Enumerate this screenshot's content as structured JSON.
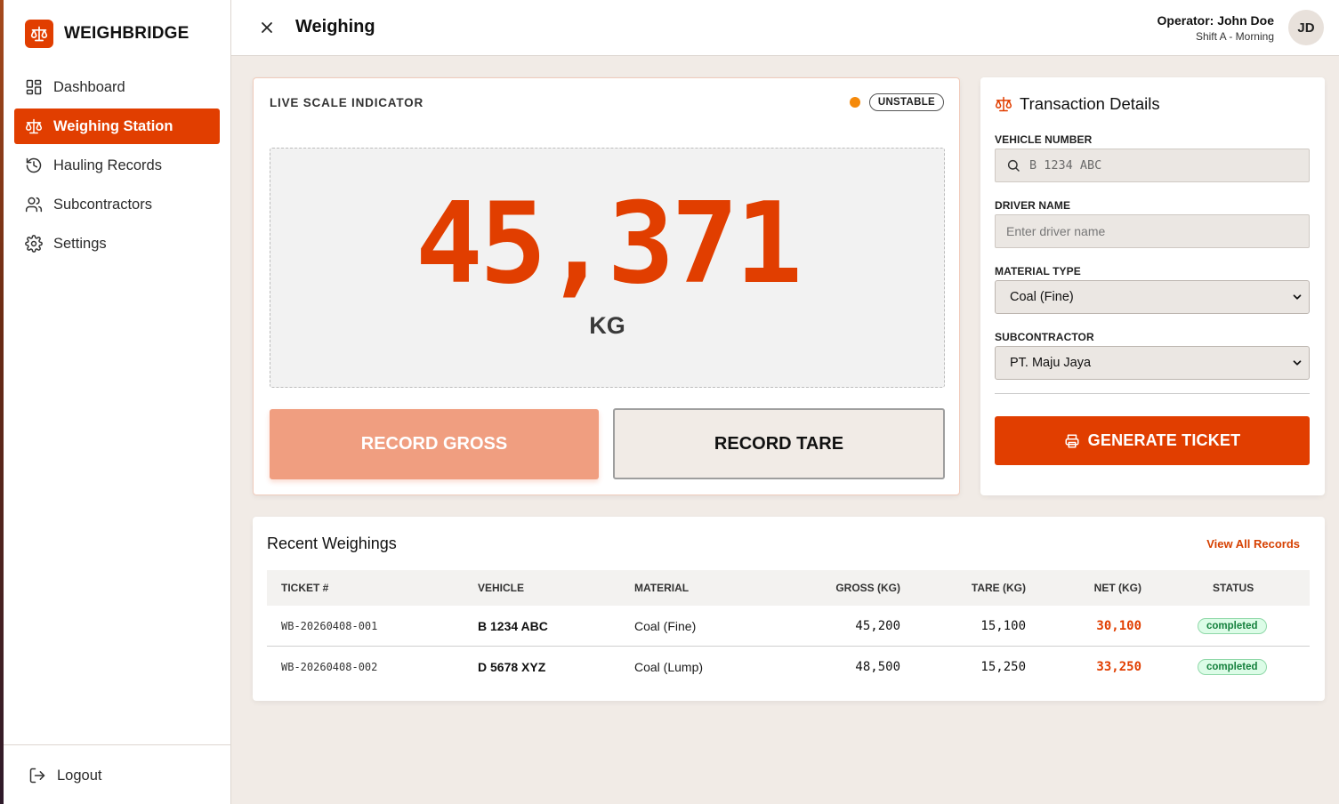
{
  "brand": {
    "name": "WEIGHBRIDGE",
    "logo_icon": "scale-icon"
  },
  "sidebar": {
    "items": [
      {
        "label": "Dashboard",
        "icon": "dashboard-icon",
        "active": false
      },
      {
        "label": "Weighing Station",
        "icon": "scale-icon",
        "active": true
      },
      {
        "label": "Hauling Records",
        "icon": "history-icon",
        "active": false
      },
      {
        "label": "Subcontractors",
        "icon": "users-icon",
        "active": false
      },
      {
        "label": "Settings",
        "icon": "gear-icon",
        "active": false
      }
    ],
    "logout_label": "Logout"
  },
  "header": {
    "title": "Weighing",
    "operator": "Operator: John Doe",
    "shift": "Shift A - Morning",
    "avatar_initials": "JD"
  },
  "scale": {
    "label": "LIVE SCALE INDICATOR",
    "status": "UNSTABLE",
    "status_color": "#f5890a",
    "value": "45,371",
    "unit": "KG",
    "record_gross_label": "RECORD GROSS",
    "record_tare_label": "RECORD TARE"
  },
  "transaction": {
    "title": "Transaction Details",
    "vehicle_label": "VEHICLE NUMBER",
    "vehicle_placeholder": "B 1234 ABC",
    "driver_label": "DRIVER NAME",
    "driver_placeholder": "Enter driver name",
    "material_label": "MATERIAL TYPE",
    "material_value": "Coal (Fine)",
    "subcontractor_label": "SUBCONTRACTOR",
    "subcontractor_value": "PT. Maju Jaya",
    "generate_label": "GENERATE TICKET"
  },
  "recent": {
    "title": "Recent Weighings",
    "view_all": "View All Records",
    "columns": [
      "TICKET #",
      "VEHICLE",
      "MATERIAL",
      "GROSS (KG)",
      "TARE (KG)",
      "NET (KG)",
      "STATUS"
    ],
    "rows": [
      {
        "ticket": "WB-20260408-001",
        "vehicle": "B 1234 ABC",
        "material": "Coal (Fine)",
        "gross": "45,200",
        "tare": "15,100",
        "net": "30,100",
        "status": "completed"
      },
      {
        "ticket": "WB-20260408-002",
        "vehicle": "D 5678 XYZ",
        "material": "Coal (Lump)",
        "gross": "48,500",
        "tare": "15,250",
        "net": "33,250",
        "status": "completed"
      }
    ]
  },
  "colors": {
    "accent": "#e13e00",
    "background": "#f1ebe6",
    "status_ok": "#15803d"
  }
}
